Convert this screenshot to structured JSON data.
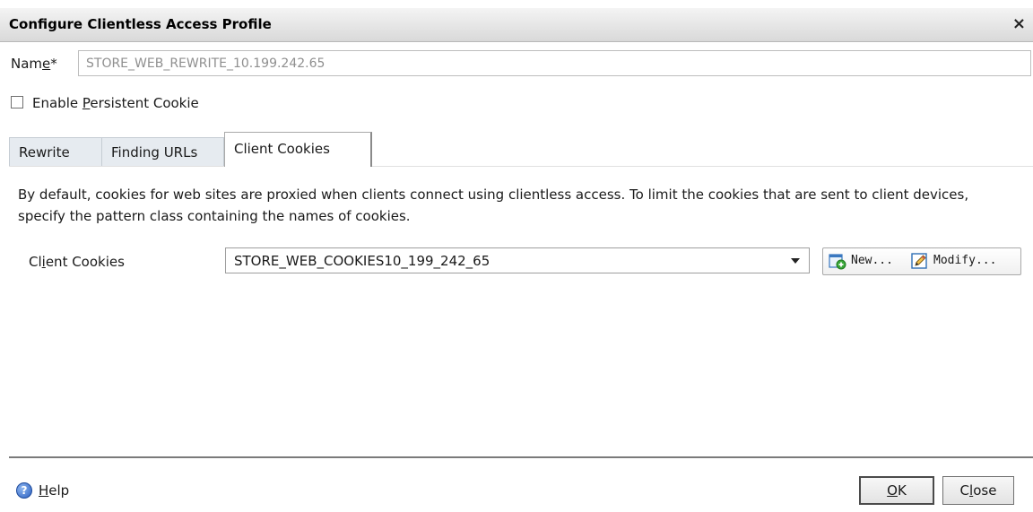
{
  "dialog": {
    "title": "Configure Clientless Access Profile",
    "close_glyph": "×"
  },
  "name_field": {
    "label_pre": "Nam",
    "label_accel": "e",
    "label_post": "*",
    "value": "STORE_WEB_REWRITE_10.199.242.65"
  },
  "persistent_cookie": {
    "label_pre": "Enable ",
    "label_accel": "P",
    "label_post": "ersistent Cookie",
    "checked": false
  },
  "tabs": [
    {
      "label": "Rewrite",
      "active": false
    },
    {
      "label": "Finding URLs",
      "active": false
    },
    {
      "label": "Client Cookies",
      "active": true
    }
  ],
  "client_cookies_tab": {
    "description": "By default, cookies for web sites are proxied when clients connect using clientless access. To limit the cookies that are sent to client devices, specify the pattern class containing the names of cookies.",
    "field_label_pre": "Cl",
    "field_label_accel": "i",
    "field_label_post": "ent Cookies",
    "selected_value": "STORE_WEB_COOKIES10_199_242_65",
    "new_button": "New...",
    "modify_button": "Modify..."
  },
  "footer": {
    "help_pre": "",
    "help_accel": "H",
    "help_post": "elp",
    "ok_accel": "O",
    "ok_post": "K",
    "close_pre": "C",
    "close_accel": "l",
    "close_post": "ose"
  },
  "icons": {
    "new": "new-document-plus-icon",
    "modify": "edit-pencil-icon",
    "help": "help-question-icon",
    "dropdown": "chevron-down-icon"
  }
}
